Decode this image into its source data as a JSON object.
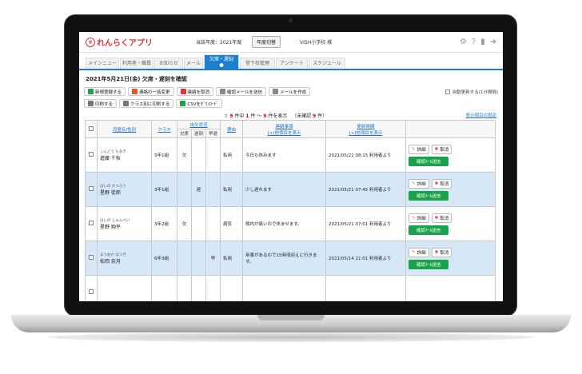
{
  "app": {
    "logo_text": "れんらくアプリ",
    "year_label": "当該年度：2021年度",
    "year_button": "年度切替",
    "user": "VISH小学校 様"
  },
  "tabs": [
    {
      "label": "メインニュー",
      "width": 42
    },
    {
      "label": "利用者・職員",
      "width": 42
    },
    {
      "label": "お知らせ",
      "width": 36
    },
    {
      "label": "メール",
      "width": 24
    },
    {
      "label": "欠席・遅刻",
      "width": 44,
      "active": true
    },
    {
      "label": "登下校管理",
      "width": 44
    },
    {
      "label": "アンケート",
      "width": 40
    },
    {
      "label": "スケジュール",
      "width": 46
    }
  ],
  "page_title": "2021年5月21日(金)  欠席・遅刻を確認",
  "toolbar": {
    "row1": [
      {
        "label": "新規登録する",
        "icon": "plus-icon",
        "color": "#1aa34a"
      },
      {
        "label": "連絡の一括変更",
        "icon": "edit-icon",
        "color": "#e05a1a"
      },
      {
        "label": "連絡を取消",
        "icon": "cancel-icon",
        "color": "#e0323c"
      },
      {
        "label": "確認メールを送信",
        "icon": "mail-icon",
        "color": "#888888"
      },
      {
        "label": "メールを作成",
        "icon": "mail-icon",
        "color": "#888888"
      }
    ],
    "row2": [
      {
        "label": "印刷する",
        "icon": "print-icon",
        "color": "#777777"
      },
      {
        "label": "クラス別に印刷する",
        "icon": "print-icon",
        "color": "#777777"
      },
      {
        "label": "CSVをﾀﾞｳﾝﾛｰﾄﾞ",
        "icon": "download-icon",
        "color": "#1aa34a"
      }
    ],
    "auto_update": "自動更新する(1分間隔)"
  },
  "summary": {
    "pre": "9",
    "mid1": "件中",
    "from": "1",
    "dash": "件 〜",
    "to": "9",
    "post": "件を表示",
    "unconfirmed_label": "（未確認",
    "unconfirmed": "9",
    "unconfirmed_post": "件）",
    "display_settings": "表示項目の設定"
  },
  "table": {
    "headers": {
      "name": "児童名/性別",
      "class": "クラス",
      "status": "出欠状況",
      "absent": "欠席",
      "late": "遅刻",
      "early": "早退",
      "reason": "理由",
      "message": "連絡事項",
      "message_sub": "[+]他項目を表示",
      "update": "更新時間",
      "update_sub": "[+]他項目を表示"
    },
    "rows": [
      {
        "kana": "しんどう ちあき",
        "name": "進藤 千秋",
        "class": "5年1組",
        "absent": "欠",
        "late": "",
        "early": "",
        "reason": "私用",
        "message": "今日も休みます",
        "update": "2021/05/21 08:15 利用者より",
        "blue": false
      },
      {
        "kana": "ほしの かつろう",
        "name": "星野 徒郎",
        "class": "3年1組",
        "absent": "",
        "late": "遅",
        "early": "",
        "reason": "私用",
        "message": "少し遅れます",
        "update": "2021/05/21 07:45 利用者より",
        "blue": true
      },
      {
        "kana": "ほしの じゅんぺい",
        "name": "星野 翔平",
        "class": "3年2組",
        "absent": "欠",
        "late": "",
        "early": "",
        "reason": "病気",
        "message": "頭内が痛いので休ませます。",
        "update": "2021/05/21 07:01 利用者より",
        "blue": false
      },
      {
        "kana": "まつおか なつき",
        "name": "松岡 奈月",
        "class": "6年3組",
        "absent": "",
        "late": "",
        "early": "早",
        "reason": "私用",
        "message": "用事があるので15時頃迎えに行きます。",
        "update": "2021/05/14 21:01 利用者より",
        "blue": true
      },
      {
        "kana": "",
        "name": "",
        "class": "",
        "absent": "",
        "late": "",
        "early": "",
        "reason": "",
        "message": "",
        "update": "",
        "blue": false
      }
    ],
    "actions": {
      "detail": "詳細",
      "cancel": "取消",
      "send": "確認ﾒｰﾙ送信"
    }
  }
}
